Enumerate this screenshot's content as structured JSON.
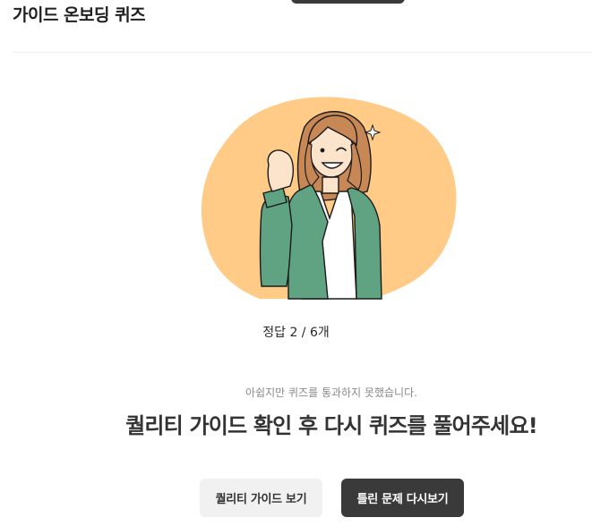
{
  "header": {
    "title": "가이드 온보딩 퀴즈"
  },
  "result": {
    "score_text": "정답 2 / 6개",
    "correct": 2,
    "total": 6,
    "sub_message": "아쉽지만 퀴즈를 통과하지 못했습니다.",
    "main_message": "퀄리티 가이드 확인 후 다시 퀴즈를 풀어주세요!"
  },
  "actions": {
    "guide_label": "퀄리티 가이드 보기",
    "retry_label": "틀린 문제 다시보기"
  },
  "colors": {
    "blob": "#FFCB87",
    "jacket": "#5FA383",
    "hair": "#C88856",
    "dark_button": "#3A3A3A",
    "light_button": "#F1F1F1"
  }
}
